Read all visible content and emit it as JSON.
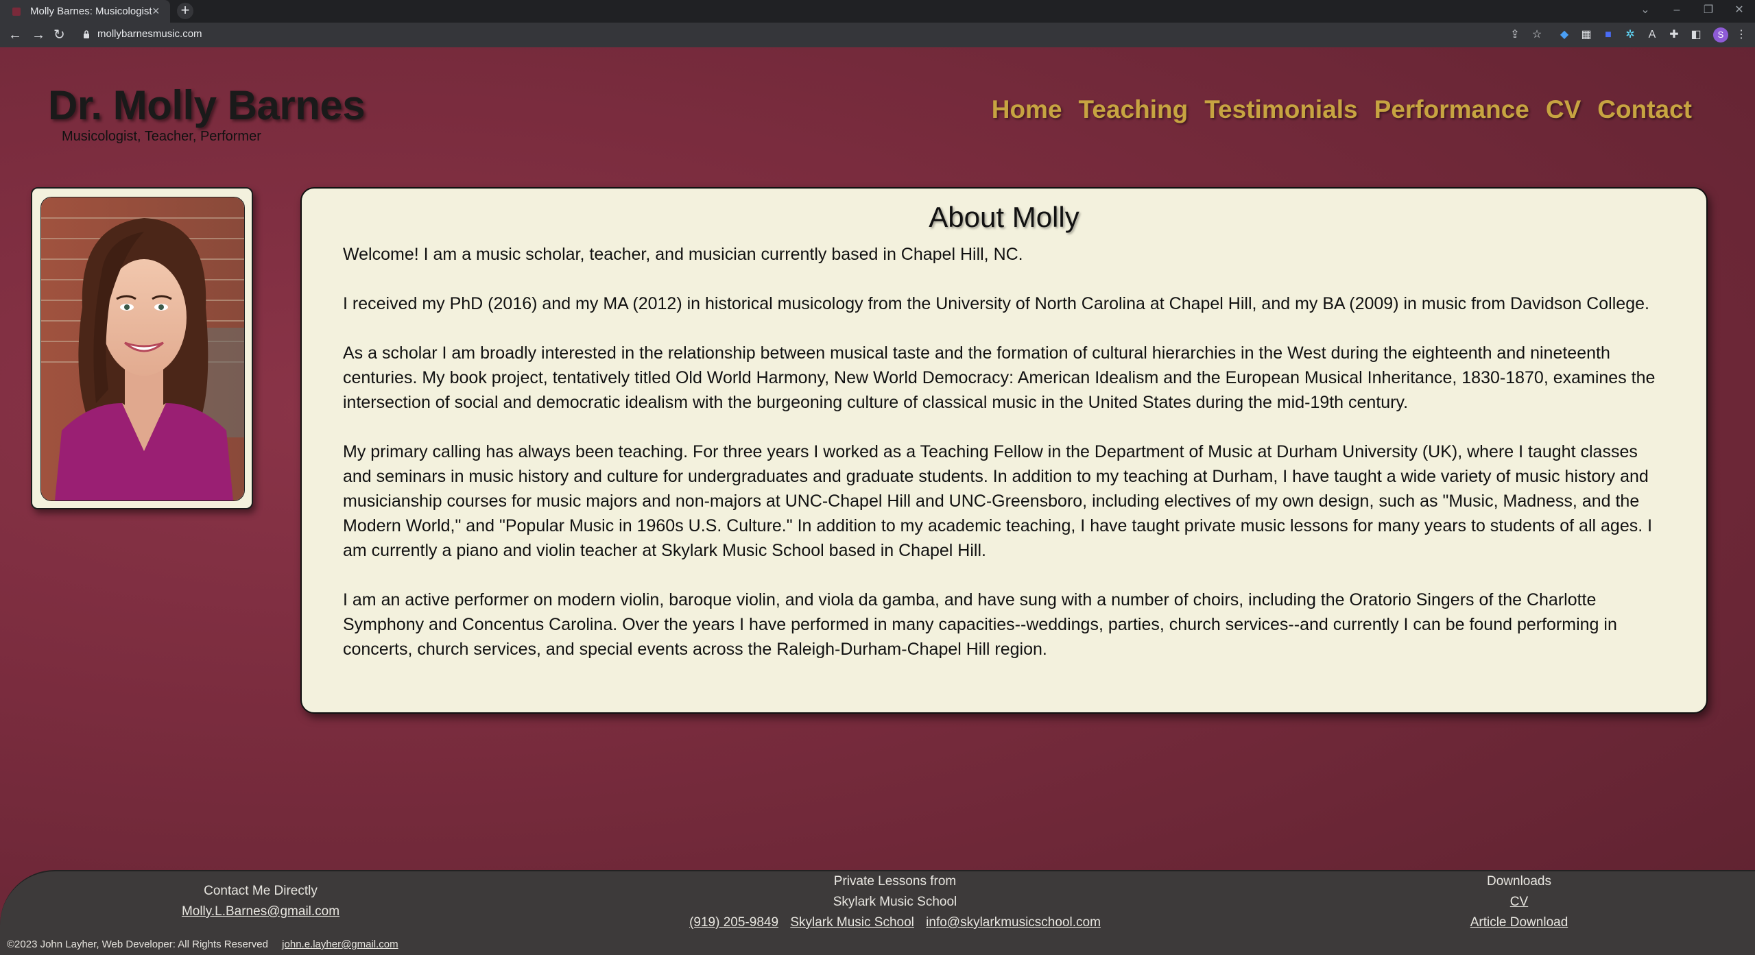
{
  "browser": {
    "tab_title": "Molly Barnes: Musicologist",
    "tab_close": "×",
    "new_tab": "+",
    "url": "mollybarnesmusic.com",
    "profile_initial": "S",
    "colors": {
      "tabbar": "#202124",
      "toolbar": "#35363a"
    }
  },
  "header": {
    "title": "Dr. Molly Barnes",
    "subtitle": "Musicologist, Teacher, Performer"
  },
  "nav": {
    "items": [
      {
        "label": "Home"
      },
      {
        "label": "Teaching"
      },
      {
        "label": "Testimonials"
      },
      {
        "label": "Performance"
      },
      {
        "label": "CV"
      },
      {
        "label": "Contact"
      }
    ],
    "color": "#c7a441"
  },
  "about": {
    "heading": "About Molly",
    "paragraphs": [
      "Welcome! I am a music scholar, teacher, and musician currently based in Chapel Hill, NC.",
      "I received my PhD (2016) and my MA (2012) in historical musicology from the University of North Carolina at Chapel Hill, and my BA (2009) in music from Davidson College.",
      "As a scholar I am broadly interested in the relationship between musical taste and the formation of cultural hierarchies in the West during the eighteenth and nineteenth centuries. My book project, tentatively titled Old World Harmony, New World Democracy: American Idealism and the European Musical Inheritance, 1830-1870, examines the intersection of social and democratic idealism with the burgeoning culture of classical music in the United States during the mid-19th century.",
      "My primary calling has always been teaching. For three years I worked as a Teaching Fellow in the Department of Music at Durham University (UK), where I taught classes and seminars in music history and culture for undergraduates and graduate students. In addition to my teaching at Durham, I have taught a wide variety of music history and musicianship courses for music majors and non-majors at UNC-Chapel Hill and UNC-Greensboro, including electives of my own design, such as \"Music, Madness, and the Modern World,\" and \"Popular Music in 1960s U.S. Culture.\" In addition to my academic teaching, I have taught private music lessons for many years to students of all ages. I am currently a piano and violin teacher at Skylark Music School based in Chapel Hill.",
      "I am an active performer on modern violin, baroque violin, and viola da gamba, and have sung with a number of choirs, including the Oratorio Singers of the Charlotte Symphony and Concentus Carolina. Over the years I have performed in many capacities--weddings, parties, church services--and currently I can be found performing in concerts, church services, and special events across the Raleigh-Durham-Chapel Hill region."
    ]
  },
  "footer": {
    "contact": {
      "heading": "Contact Me Directly",
      "email": "Molly.L.Barnes@gmail.com"
    },
    "lessons": {
      "line1": "Private Lessons from",
      "line2": "Skylark Music School",
      "phone": "(919) 205-9849",
      "school": "Skylark Music School",
      "email": "info@skylarkmusicschool.com"
    },
    "downloads": {
      "heading": "Downloads",
      "cv": "CV",
      "article": "Article Download"
    },
    "copyright": "©2023 John Layher,  Web Developer:  All Rights Reserved",
    "dev_email": "john.e.layher@gmail.com"
  },
  "colors": {
    "page_background": "#7a2c3e",
    "card_background": "#f3f1dd",
    "footer_background": "#3d3a3a"
  }
}
